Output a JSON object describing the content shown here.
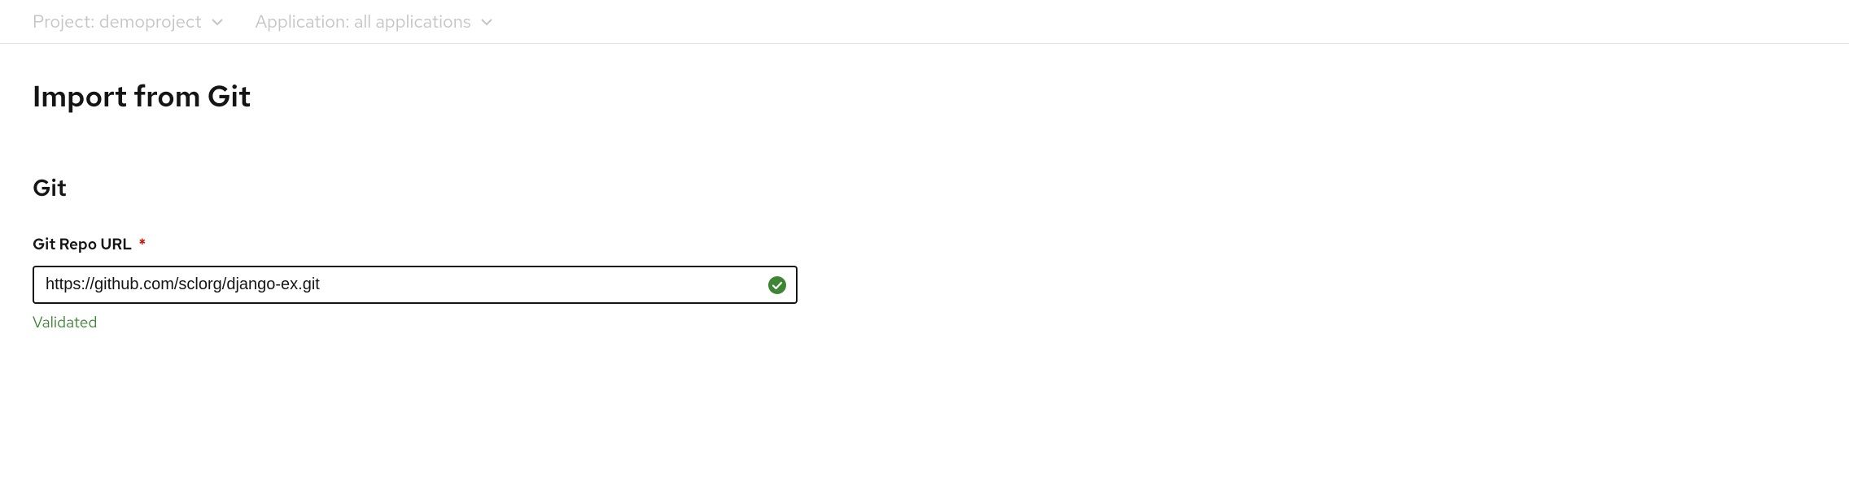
{
  "topbar": {
    "project": {
      "label": "Project:",
      "value": "demoproject"
    },
    "application": {
      "label": "Application:",
      "value": "all applications"
    }
  },
  "page": {
    "title": "Import from Git"
  },
  "section": {
    "title": "Git"
  },
  "form": {
    "git_repo": {
      "label": "Git Repo URL",
      "required_marker": "*",
      "value": "https://github.com/sclorg/django-ex.git",
      "status_icon_name": "check-circle",
      "validation_text": "Validated"
    }
  },
  "colors": {
    "muted": "#c5c5c5",
    "text": "#151515",
    "success": "#3e8635",
    "danger": "#c9190b"
  }
}
